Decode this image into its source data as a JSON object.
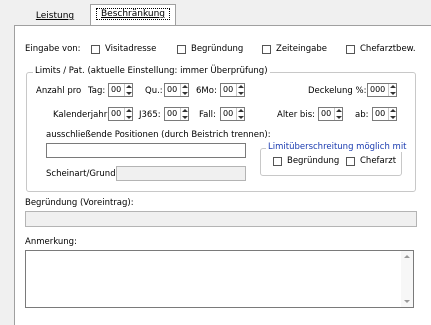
{
  "tabs": {
    "leistung": "Leistung",
    "beschraenkung": "Beschränkung"
  },
  "eingabe": {
    "label": "Eingabe von:",
    "options": [
      "Visitadresse",
      "Begründung",
      "Zeiteingabe",
      "Chefarztbew."
    ]
  },
  "limits": {
    "legend": "Limits / Pat.  (aktuelle Einstellung: immer Überprüfung)",
    "anzahl_pro": "Anzahl pro",
    "tag": "Tag:",
    "qu": "Qu.:",
    "mo6": "6Mo:",
    "deckelung": "Deckelung %:",
    "kalenderjahr": "Kalenderjahr:",
    "j365": "J365:",
    "fall": "Fall:",
    "alter_bis": "Alter bis:",
    "ab": "ab:",
    "spin_value": "00",
    "deckelung_value": "000",
    "positionen_label": "ausschließende Positionen (durch Beistrich trennen):",
    "scheinart_label": "Scheinart/Grund:"
  },
  "limitueber": {
    "legend": "Limitüberschreitung möglich mit",
    "begruendung": "Begründung",
    "chefarzt": "Chefarzt"
  },
  "begruendung_vor": "Begründung (Voreintrag):",
  "anmerkung": "Anmerkung:"
}
